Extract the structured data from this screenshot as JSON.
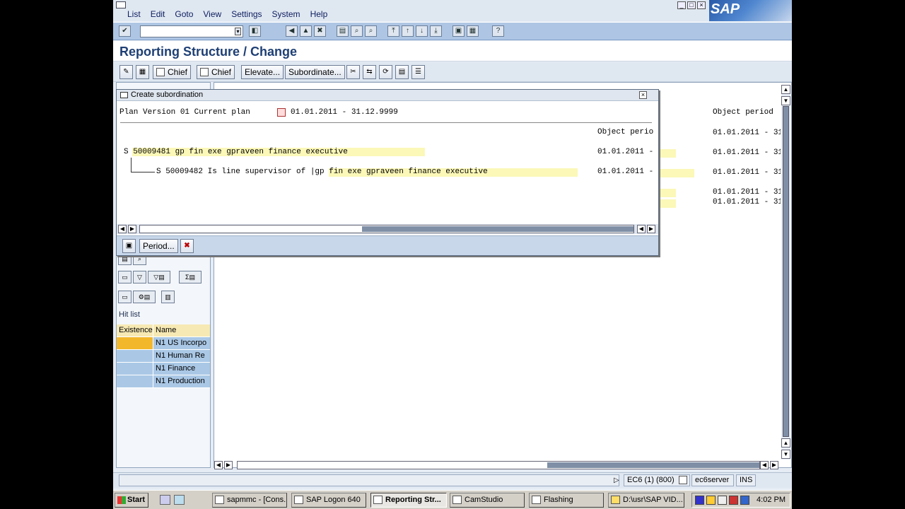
{
  "menu": [
    "List",
    "Edit",
    "Goto",
    "View",
    "Settings",
    "System",
    "Help"
  ],
  "brand": "SAP",
  "page_title": "Reporting Structure / Change",
  "app_toolbar": {
    "chief_create": "Chief",
    "chief_delete": "Chief",
    "elevate": "Elevate...",
    "subordinate": "Subordinate..."
  },
  "dialog": {
    "title": "Create subordination",
    "plan_version": "Plan Version 01 Current plan",
    "validity": "01.01.2011 - 31.12.9999",
    "col_header": "Object perio",
    "row1": "S  50009481 gp  fin exe  gpraveen finance executive",
    "row1_period": "01.01.2011 -",
    "row2": "S  50009482 Is line supervisor of    |gp  fin exe  gpraveen finance executive",
    "row2_period": "01.01.2011 -",
    "period_button": "Period..."
  },
  "right_panel": {
    "header": "Object period",
    "dates": [
      "01.01.2011 - 31",
      "01.01.2011 - 31",
      "01.01.2011 - 31",
      "01.01.2011 - 31",
      "01.01.2011 - 31"
    ]
  },
  "hit_list": {
    "label": "Hit list",
    "col_existence": "Existence",
    "col_name": "Name",
    "rows": [
      "N1 US Incorpo",
      "N1 Human Re",
      "N1 Finance",
      "N1 Production"
    ]
  },
  "status": {
    "system": "EC6 (1) (800)",
    "server": "ec6server",
    "mode": "INS"
  },
  "taskbar": {
    "start": "Start",
    "tasks": [
      "sapmmc - [Cons...",
      "SAP Logon 640",
      "Reporting Str...",
      "CamStudio",
      "Flashing",
      "D:\\usr\\SAP VID..."
    ],
    "clock": "4:02 PM"
  },
  "colors": {
    "sap_blue": "#1e3f74",
    "toolbar_blue": "#aec6e4",
    "highlight_yellow": "#fbf8b8",
    "selected_orange": "#f2b72a"
  }
}
